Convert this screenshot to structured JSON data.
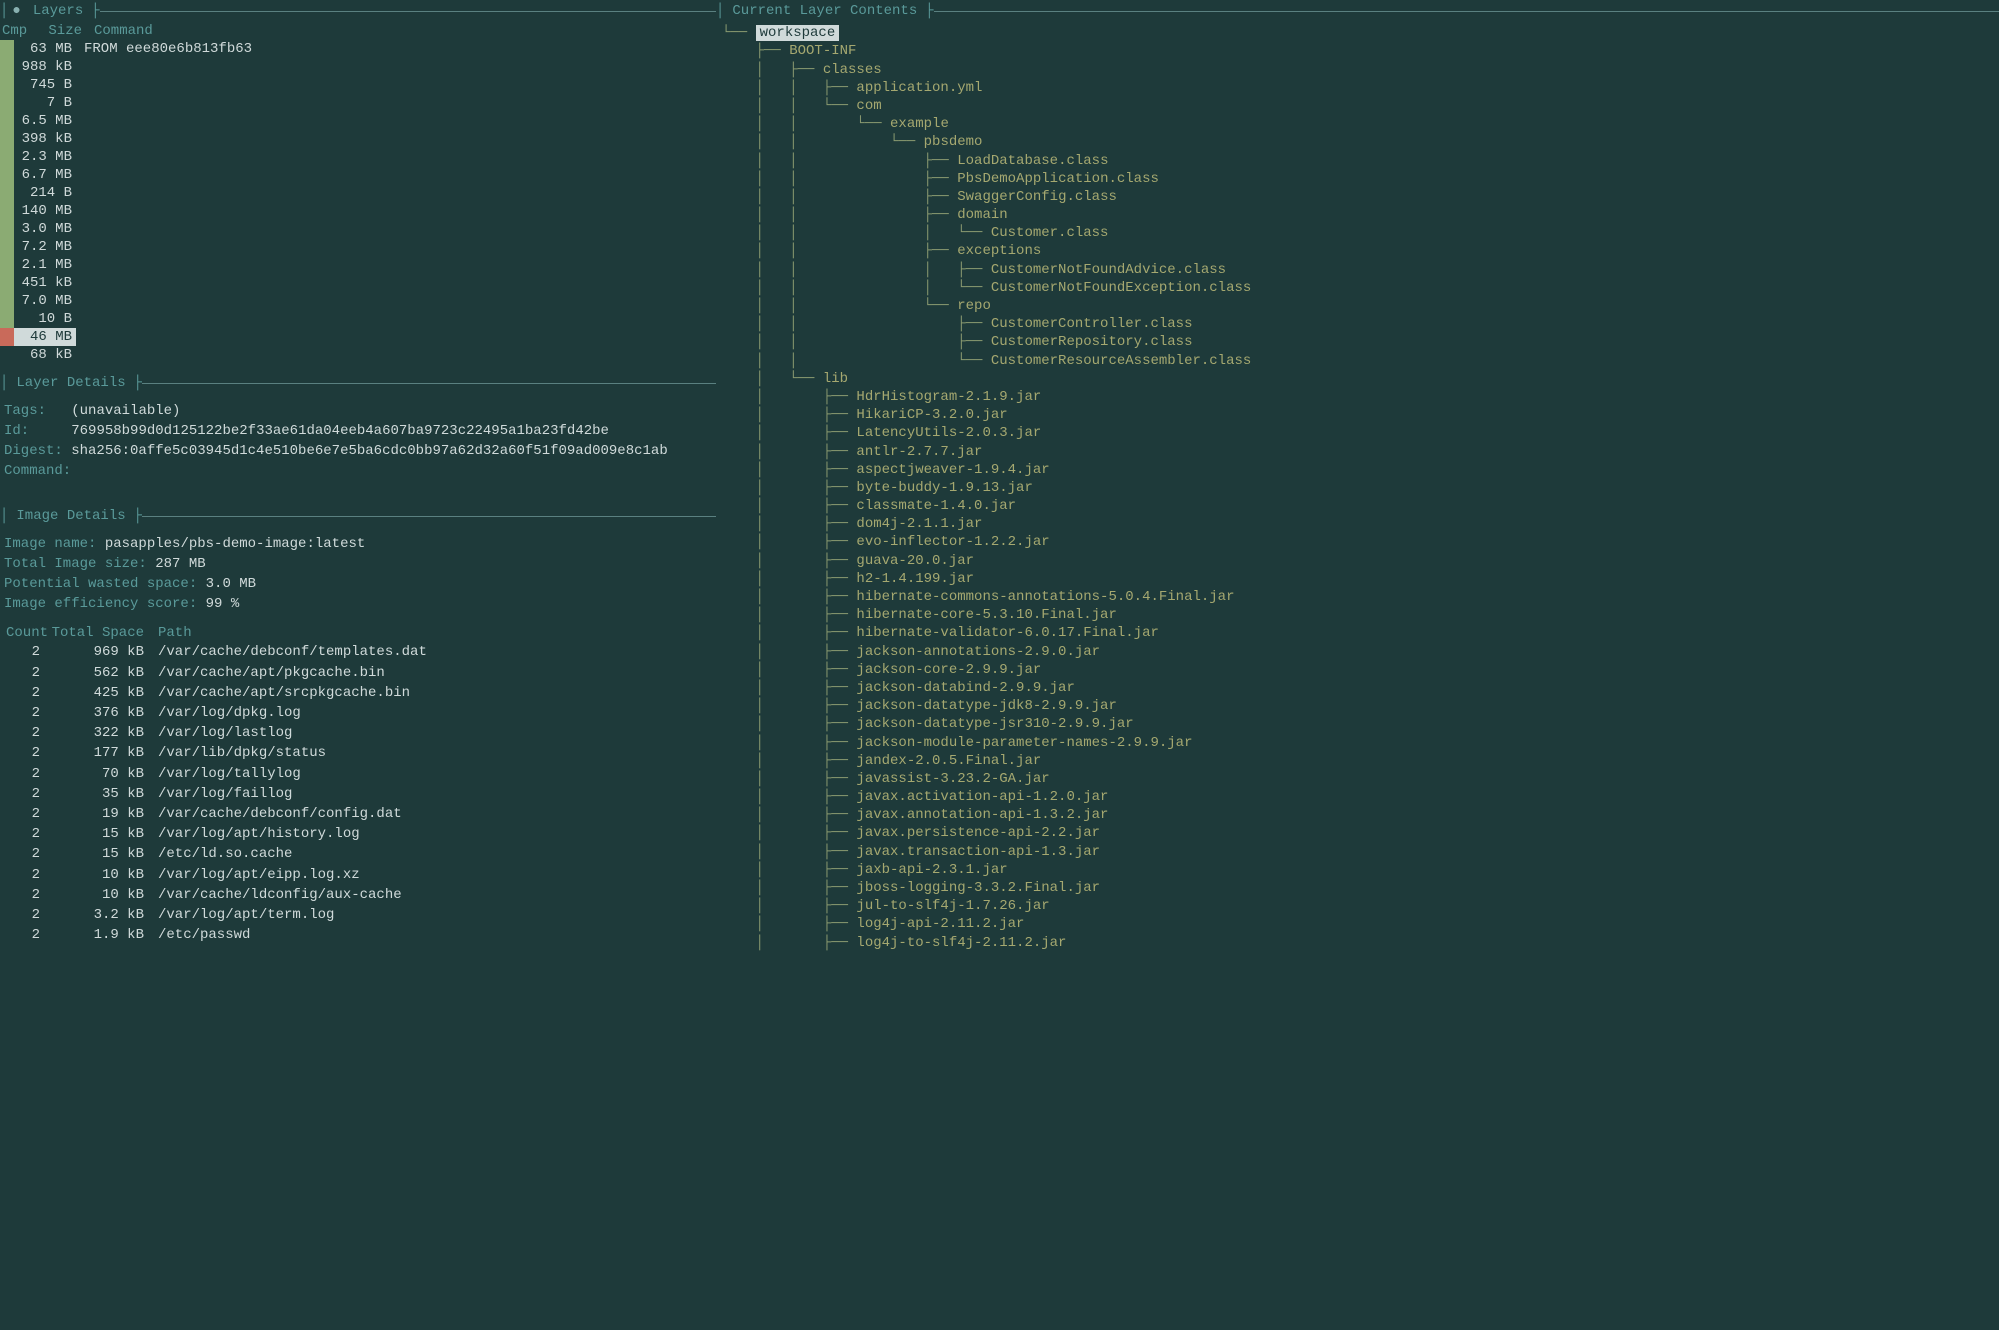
{
  "panels": {
    "layers_title": "Layers",
    "contents_title": "Current Layer Contents",
    "layer_details_title": "Layer Details",
    "image_details_title": "Image Details"
  },
  "layers_header": {
    "cmp": "Cmp",
    "size": "Size",
    "command": "Command"
  },
  "layers": [
    {
      "bar": "green",
      "size": "63 MB",
      "cmd": "FROM eee80e6b813fb63",
      "selected": false
    },
    {
      "bar": "green",
      "size": "988 kB",
      "cmd": "",
      "selected": false
    },
    {
      "bar": "green",
      "size": "745 B",
      "cmd": "",
      "selected": false
    },
    {
      "bar": "green",
      "size": "7 B",
      "cmd": "",
      "selected": false
    },
    {
      "bar": "green",
      "size": "6.5 MB",
      "cmd": "",
      "selected": false
    },
    {
      "bar": "green",
      "size": "398 kB",
      "cmd": "",
      "selected": false
    },
    {
      "bar": "green",
      "size": "2.3 MB",
      "cmd": "",
      "selected": false
    },
    {
      "bar": "green",
      "size": "6.7 MB",
      "cmd": "",
      "selected": false
    },
    {
      "bar": "green",
      "size": "214 B",
      "cmd": "",
      "selected": false
    },
    {
      "bar": "green",
      "size": "140 MB",
      "cmd": "",
      "selected": false
    },
    {
      "bar": "green",
      "size": "3.0 MB",
      "cmd": "",
      "selected": false
    },
    {
      "bar": "green",
      "size": "7.2 MB",
      "cmd": "",
      "selected": false
    },
    {
      "bar": "green",
      "size": "2.1 MB",
      "cmd": "",
      "selected": false
    },
    {
      "bar": "green",
      "size": "451 kB",
      "cmd": "",
      "selected": false
    },
    {
      "bar": "green",
      "size": "7.0 MB",
      "cmd": "",
      "selected": false
    },
    {
      "bar": "green",
      "size": "10 B",
      "cmd": "",
      "selected": false
    },
    {
      "bar": "red",
      "size": "46 MB",
      "cmd": "",
      "selected": true
    },
    {
      "bar": "",
      "size": "68 kB",
      "cmd": "",
      "selected": false
    }
  ],
  "layer_details": {
    "tags_label": "Tags:",
    "tags_value": "(unavailable)",
    "id_label": "Id:",
    "id_value": "769958b99d0d125122be2f33ae61da04eeb4a607ba9723c22495a1ba23fd42be",
    "digest_label": "Digest:",
    "digest_value": "sha256:0affe5c03945d1c4e510be6e7e5ba6cdc0bb97a62d32a60f51f09ad009e8c1ab",
    "command_label": "Command:",
    "command_value": ""
  },
  "image_details": {
    "name_label": "Image name:",
    "name_value": "pasapples/pbs-demo-image:latest",
    "total_label": "Total Image size:",
    "total_value": "287 MB",
    "wasted_label": "Potential wasted space:",
    "wasted_value": "3.0 MB",
    "eff_label": "Image efficiency score:",
    "eff_value": "99 %"
  },
  "waste_header": {
    "count": "Count",
    "space": "Total Space",
    "path": "Path"
  },
  "waste_rows": [
    {
      "count": "2",
      "space": "969 kB",
      "path": "/var/cache/debconf/templates.dat"
    },
    {
      "count": "2",
      "space": "562 kB",
      "path": "/var/cache/apt/pkgcache.bin"
    },
    {
      "count": "2",
      "space": "425 kB",
      "path": "/var/cache/apt/srcpkgcache.bin"
    },
    {
      "count": "2",
      "space": "376 kB",
      "path": "/var/log/dpkg.log"
    },
    {
      "count": "2",
      "space": "322 kB",
      "path": "/var/log/lastlog"
    },
    {
      "count": "2",
      "space": "177 kB",
      "path": "/var/lib/dpkg/status"
    },
    {
      "count": "2",
      "space": "70 kB",
      "path": "/var/log/tallylog"
    },
    {
      "count": "2",
      "space": "35 kB",
      "path": "/var/log/faillog"
    },
    {
      "count": "2",
      "space": "19 kB",
      "path": "/var/cache/debconf/config.dat"
    },
    {
      "count": "2",
      "space": "15 kB",
      "path": "/var/log/apt/history.log"
    },
    {
      "count": "2",
      "space": "15 kB",
      "path": "/etc/ld.so.cache"
    },
    {
      "count": "2",
      "space": "10 kB",
      "path": "/var/log/apt/eipp.log.xz"
    },
    {
      "count": "2",
      "space": "10 kB",
      "path": "/var/cache/ldconfig/aux-cache"
    },
    {
      "count": "2",
      "space": "3.2 kB",
      "path": "/var/log/apt/term.log"
    },
    {
      "count": "2",
      "space": "1.9 kB",
      "path": "/etc/passwd"
    }
  ],
  "tree": [
    {
      "indent": "└── ",
      "name": "workspace",
      "style": "inverted"
    },
    {
      "indent": "    ├── ",
      "name": "BOOT-INF",
      "style": ""
    },
    {
      "indent": "    │   ├── ",
      "name": "classes",
      "style": ""
    },
    {
      "indent": "    │   │   ├── ",
      "name": "application.yml",
      "style": ""
    },
    {
      "indent": "    │   │   └── ",
      "name": "com",
      "style": ""
    },
    {
      "indent": "    │   │       └── ",
      "name": "example",
      "style": ""
    },
    {
      "indent": "    │   │           └── ",
      "name": "pbsdemo",
      "style": ""
    },
    {
      "indent": "    │   │               ├── ",
      "name": "LoadDatabase.class",
      "style": ""
    },
    {
      "indent": "    │   │               ├── ",
      "name": "PbsDemoApplication.class",
      "style": ""
    },
    {
      "indent": "    │   │               ├── ",
      "name": "SwaggerConfig.class",
      "style": ""
    },
    {
      "indent": "    │   │               ├── ",
      "name": "domain",
      "style": ""
    },
    {
      "indent": "    │   │               │   └── ",
      "name": "Customer.class",
      "style": ""
    },
    {
      "indent": "    │   │               ├── ",
      "name": "exceptions",
      "style": ""
    },
    {
      "indent": "    │   │               │   ├── ",
      "name": "CustomerNotFoundAdvice.class",
      "style": ""
    },
    {
      "indent": "    │   │               │   └── ",
      "name": "CustomerNotFoundException.class",
      "style": ""
    },
    {
      "indent": "    │   │               └── ",
      "name": "repo",
      "style": ""
    },
    {
      "indent": "    │   │                   ├── ",
      "name": "CustomerController.class",
      "style": ""
    },
    {
      "indent": "    │   │                   ├── ",
      "name": "CustomerRepository.class",
      "style": ""
    },
    {
      "indent": "    │   │                   └── ",
      "name": "CustomerResourceAssembler.class",
      "style": ""
    },
    {
      "indent": "    │   └── ",
      "name": "lib",
      "style": ""
    },
    {
      "indent": "    │       ├── ",
      "name": "HdrHistogram-2.1.9.jar",
      "style": ""
    },
    {
      "indent": "    │       ├── ",
      "name": "HikariCP-3.2.0.jar",
      "style": ""
    },
    {
      "indent": "    │       ├── ",
      "name": "LatencyUtils-2.0.3.jar",
      "style": ""
    },
    {
      "indent": "    │       ├── ",
      "name": "antlr-2.7.7.jar",
      "style": ""
    },
    {
      "indent": "    │       ├── ",
      "name": "aspectjweaver-1.9.4.jar",
      "style": ""
    },
    {
      "indent": "    │       ├── ",
      "name": "byte-buddy-1.9.13.jar",
      "style": ""
    },
    {
      "indent": "    │       ├── ",
      "name": "classmate-1.4.0.jar",
      "style": ""
    },
    {
      "indent": "    │       ├── ",
      "name": "dom4j-2.1.1.jar",
      "style": ""
    },
    {
      "indent": "    │       ├── ",
      "name": "evo-inflector-1.2.2.jar",
      "style": ""
    },
    {
      "indent": "    │       ├── ",
      "name": "guava-20.0.jar",
      "style": ""
    },
    {
      "indent": "    │       ├── ",
      "name": "h2-1.4.199.jar",
      "style": ""
    },
    {
      "indent": "    │       ├── ",
      "name": "hibernate-commons-annotations-5.0.4.Final.jar",
      "style": ""
    },
    {
      "indent": "    │       ├── ",
      "name": "hibernate-core-5.3.10.Final.jar",
      "style": ""
    },
    {
      "indent": "    │       ├── ",
      "name": "hibernate-validator-6.0.17.Final.jar",
      "style": ""
    },
    {
      "indent": "    │       ├── ",
      "name": "jackson-annotations-2.9.0.jar",
      "style": ""
    },
    {
      "indent": "    │       ├── ",
      "name": "jackson-core-2.9.9.jar",
      "style": ""
    },
    {
      "indent": "    │       ├── ",
      "name": "jackson-databind-2.9.9.jar",
      "style": ""
    },
    {
      "indent": "    │       ├── ",
      "name": "jackson-datatype-jdk8-2.9.9.jar",
      "style": ""
    },
    {
      "indent": "    │       ├── ",
      "name": "jackson-datatype-jsr310-2.9.9.jar",
      "style": ""
    },
    {
      "indent": "    │       ├── ",
      "name": "jackson-module-parameter-names-2.9.9.jar",
      "style": ""
    },
    {
      "indent": "    │       ├── ",
      "name": "jandex-2.0.5.Final.jar",
      "style": ""
    },
    {
      "indent": "    │       ├── ",
      "name": "javassist-3.23.2-GA.jar",
      "style": ""
    },
    {
      "indent": "    │       ├── ",
      "name": "javax.activation-api-1.2.0.jar",
      "style": ""
    },
    {
      "indent": "    │       ├── ",
      "name": "javax.annotation-api-1.3.2.jar",
      "style": ""
    },
    {
      "indent": "    │       ├── ",
      "name": "javax.persistence-api-2.2.jar",
      "style": ""
    },
    {
      "indent": "    │       ├── ",
      "name": "javax.transaction-api-1.3.jar",
      "style": ""
    },
    {
      "indent": "    │       ├── ",
      "name": "jaxb-api-2.3.1.jar",
      "style": ""
    },
    {
      "indent": "    │       ├── ",
      "name": "jboss-logging-3.3.2.Final.jar",
      "style": ""
    },
    {
      "indent": "    │       ├── ",
      "name": "jul-to-slf4j-1.7.26.jar",
      "style": ""
    },
    {
      "indent": "    │       ├── ",
      "name": "log4j-api-2.11.2.jar",
      "style": ""
    },
    {
      "indent": "    │       ├── ",
      "name": "log4j-to-slf4j-2.11.2.jar",
      "style": ""
    }
  ]
}
